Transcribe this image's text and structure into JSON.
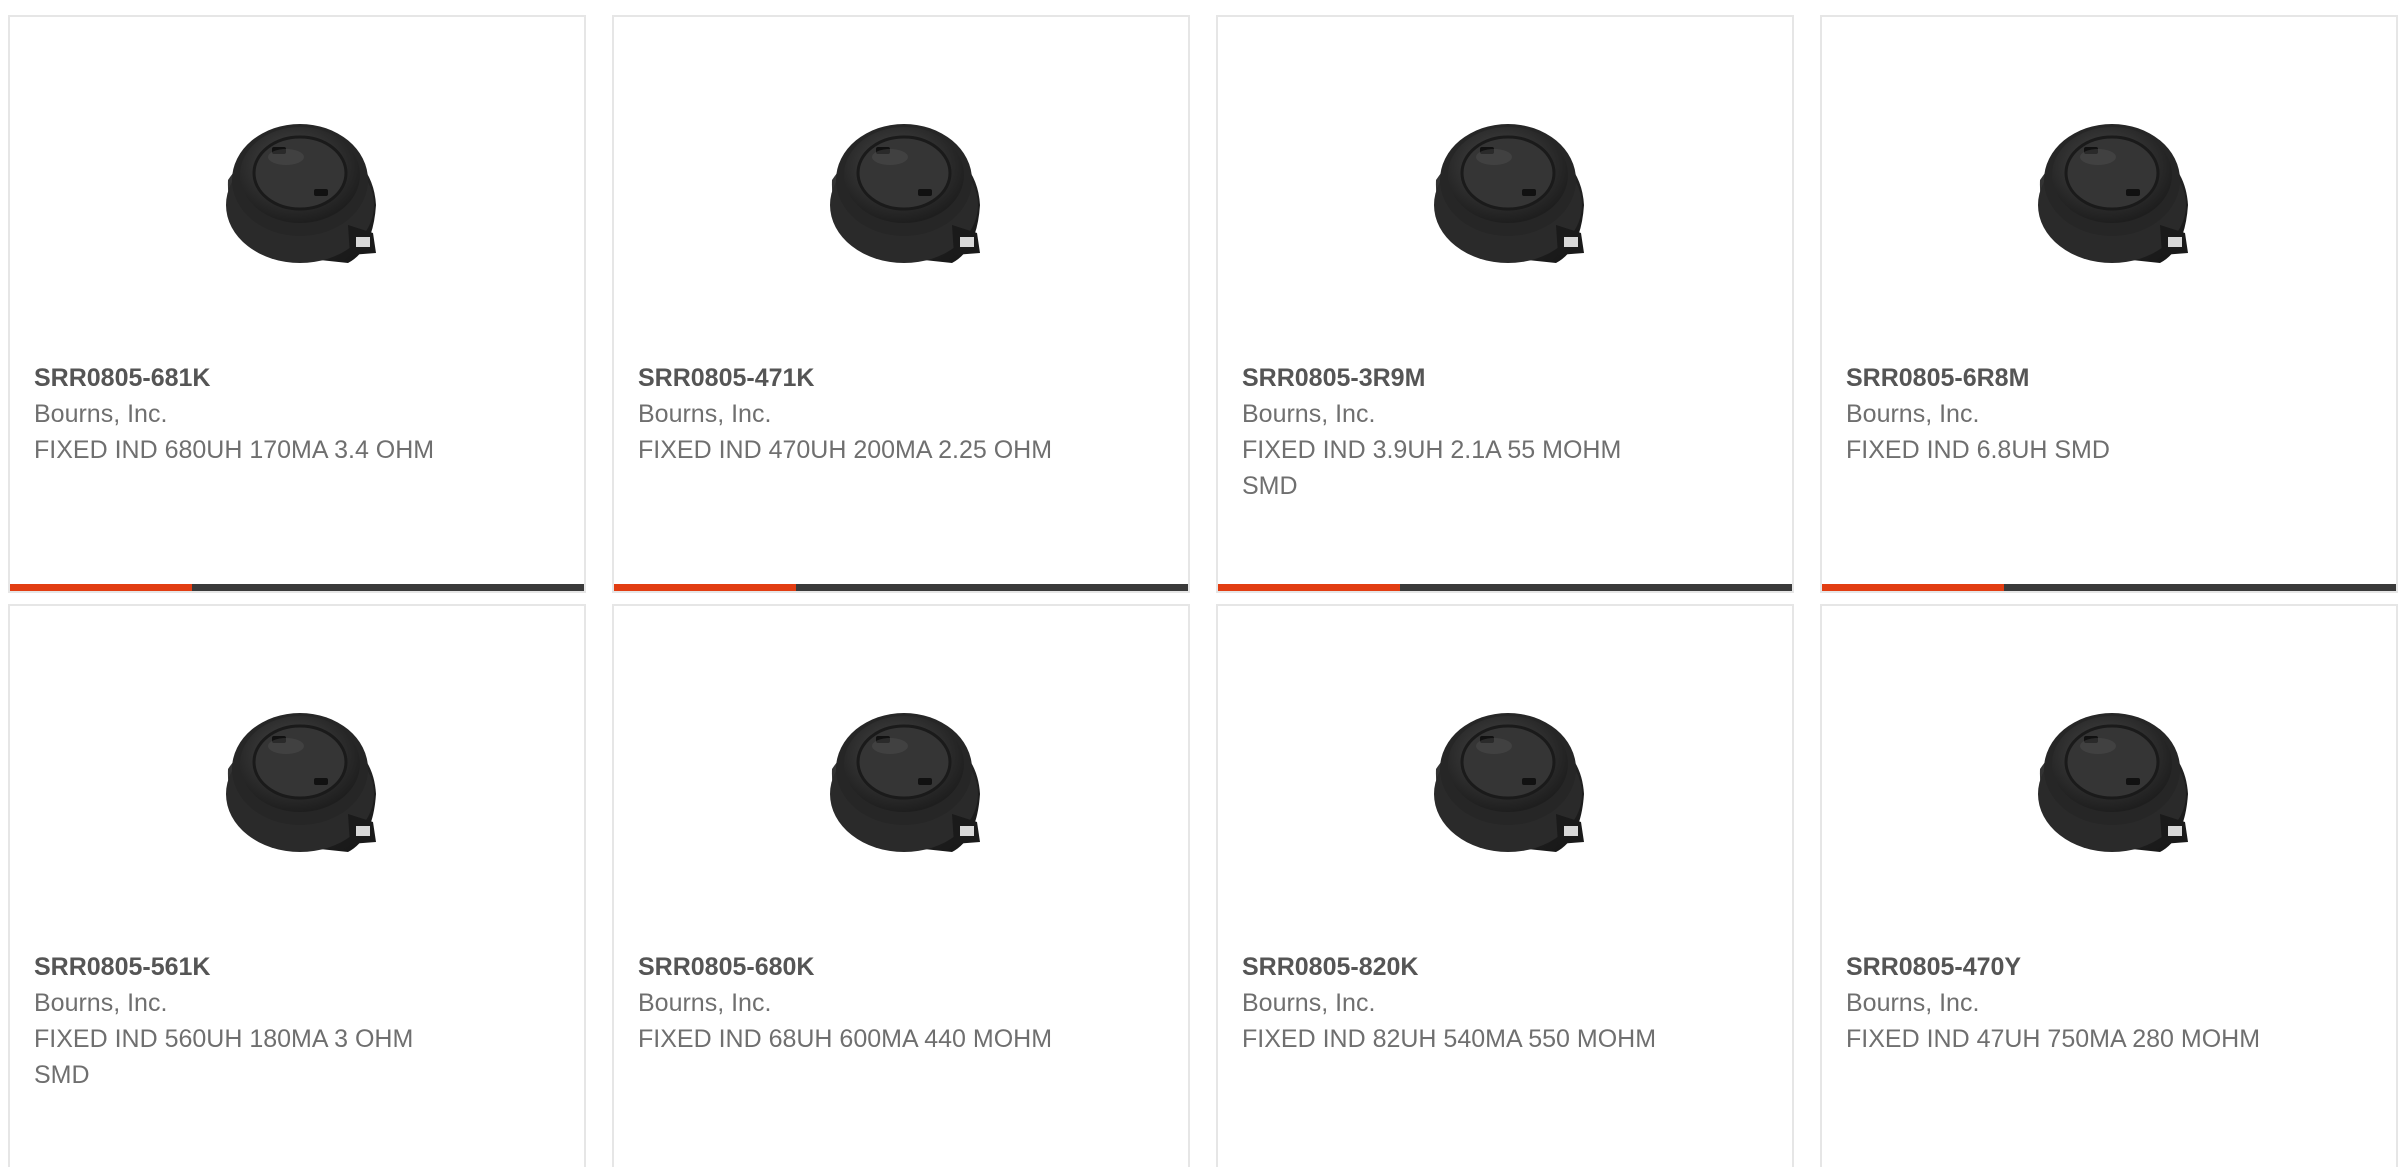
{
  "colors": {
    "accent": "#e23d12",
    "bar": "#3a3a3a",
    "border": "#e6e6e6"
  },
  "products": [
    {
      "part_number": "SRR0805-681K",
      "manufacturer": "Bourns, Inc.",
      "description": "FIXED IND 680UH 170MA 3.4 OHM",
      "image_icon": "inductor-image"
    },
    {
      "part_number": "SRR0805-471K",
      "manufacturer": "Bourns, Inc.",
      "description": "FIXED IND 470UH 200MA 2.25 OHM",
      "image_icon": "inductor-image"
    },
    {
      "part_number": "SRR0805-3R9M",
      "manufacturer": "Bourns, Inc.",
      "description": "FIXED IND 3.9UH 2.1A 55 MOHM SMD",
      "image_icon": "inductor-image"
    },
    {
      "part_number": "SRR0805-6R8M",
      "manufacturer": "Bourns, Inc.",
      "description": "FIXED IND 6.8UH SMD",
      "image_icon": "inductor-image"
    },
    {
      "part_number": "SRR0805-561K",
      "manufacturer": "Bourns, Inc.",
      "description": "FIXED IND 560UH 180MA 3 OHM SMD",
      "image_icon": "inductor-image"
    },
    {
      "part_number": "SRR0805-680K",
      "manufacturer": "Bourns, Inc.",
      "description": "FIXED IND 68UH 600MA 440 MOHM",
      "image_icon": "inductor-image"
    },
    {
      "part_number": "SRR0805-820K",
      "manufacturer": "Bourns, Inc.",
      "description": "FIXED IND 82UH 540MA 550 MOHM",
      "image_icon": "inductor-image"
    },
    {
      "part_number": "SRR0805-470Y",
      "manufacturer": "Bourns, Inc.",
      "description": "FIXED IND 47UH 750MA 280 MOHM",
      "image_icon": "inductor-image"
    }
  ]
}
